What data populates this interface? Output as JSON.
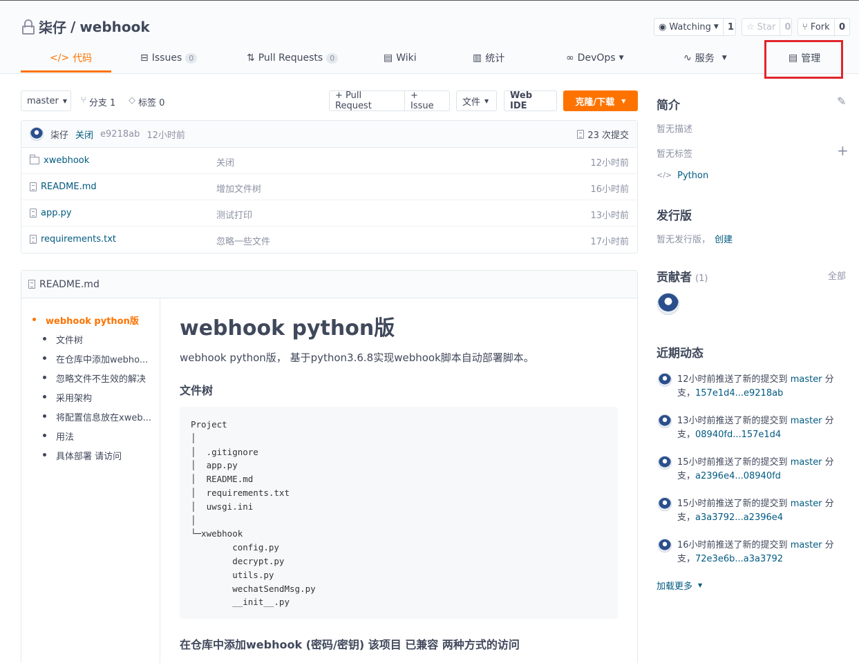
{
  "repo": {
    "owner": "柒仔",
    "sep": "/",
    "name": "webhook"
  },
  "header_buttons": {
    "watch": {
      "label": "Watching",
      "count": "1"
    },
    "star": {
      "label": "Star",
      "count": "0"
    },
    "fork": {
      "label": "Fork",
      "count": "0"
    }
  },
  "tabs": [
    {
      "label": "代码"
    },
    {
      "label": "Issues",
      "badge": "0"
    },
    {
      "label": "Pull Requests",
      "badge": "0"
    },
    {
      "label": "Wiki"
    },
    {
      "label": "统计"
    },
    {
      "label": "DevOps"
    },
    {
      "label": "服务"
    },
    {
      "label": "管理"
    }
  ],
  "toolbar": {
    "branch": "master",
    "branches": "分支 1",
    "tags": "标签 0",
    "pull_request": "+ Pull Request",
    "issue": "+ Issue",
    "file": "文件",
    "web_ide": "Web IDE",
    "clone": "克隆/下载"
  },
  "commit": {
    "author": "柒仔",
    "message": "关闭",
    "hash": "e9218ab",
    "time": "12小时前",
    "count": "23 次提交"
  },
  "files": [
    {
      "name": "xwebhook",
      "type": "folder",
      "message": "关闭",
      "time": "12小时前"
    },
    {
      "name": "README.md",
      "type": "file",
      "message": "增加文件树",
      "time": "16小时前"
    },
    {
      "name": "app.py",
      "type": "file",
      "message": "测试打印",
      "time": "13小时前"
    },
    {
      "name": "requirements.txt",
      "type": "file",
      "message": "忽略一些文件",
      "time": "17小时前"
    }
  ],
  "readme": {
    "filename": "README.md",
    "toc": [
      {
        "level": 1,
        "text": "webhook python版"
      },
      {
        "level": 2,
        "text": "文件树"
      },
      {
        "level": 2,
        "text": "在仓库中添加webho..."
      },
      {
        "level": 2,
        "text": "忽略文件不生效的解决"
      },
      {
        "level": 2,
        "text": "采用架构"
      },
      {
        "level": 2,
        "text": "将配置信息放在xweb..."
      },
      {
        "level": 2,
        "text": "用法"
      },
      {
        "level": 2,
        "text": "具体部署 请访问"
      }
    ],
    "title": "webhook python版",
    "intro": "webhook python版， 基于python3.6.8实现webhook脚本自动部署脚本。",
    "h2_tree": "文件树",
    "code": "Project\n│\n│  .gitignore\n│  app.py\n│  README.md\n│  requirements.txt\n│  uwsgi.ini\n│\n└─xwebhook\n        config.py\n        decrypt.py\n        utils.py\n        wechatSendMsg.py\n        __init__.py",
    "h2_next": "在仓库中添加webhook (密码/密钥) 该项目 已兼容 两种方式的访问"
  },
  "sidebar": {
    "intro_title": "简介",
    "no_desc": "暂无描述",
    "no_tags": "暂无标签",
    "language": "Python",
    "release_title": "发行版",
    "no_release": "暂无发行版，",
    "create": "创建",
    "contrib_title": "贡献者",
    "contrib_count": "(1)",
    "contrib_all": "全部",
    "activity_title": "近期动态",
    "activities": [
      {
        "prefix": "12小时前推送了新的提交到",
        "branch": "master",
        "suffix1": "分",
        "suffix2": "支，",
        "range": "157e1d4...e9218ab"
      },
      {
        "prefix": "13小时前推送了新的提交到",
        "branch": "master",
        "suffix1": "分",
        "suffix2": "支，",
        "range": "08940fd...157e1d4"
      },
      {
        "prefix": "15小时前推送了新的提交到",
        "branch": "master",
        "suffix1": "分",
        "suffix2": "支，",
        "range": "a2396e4...08940fd"
      },
      {
        "prefix": "15小时前推送了新的提交到",
        "branch": "master",
        "suffix1": "分",
        "suffix2": "支，",
        "range": "a3a3792...a2396e4"
      },
      {
        "prefix": "16小时前推送了新的提交到",
        "branch": "master",
        "suffix1": "分",
        "suffix2": "支，",
        "range": "72e3e6b...a3a3792"
      }
    ],
    "load_more": "加载更多"
  },
  "colors": {
    "accent": "#fe7300",
    "link": "#005980",
    "highlight": "#e0252c"
  }
}
